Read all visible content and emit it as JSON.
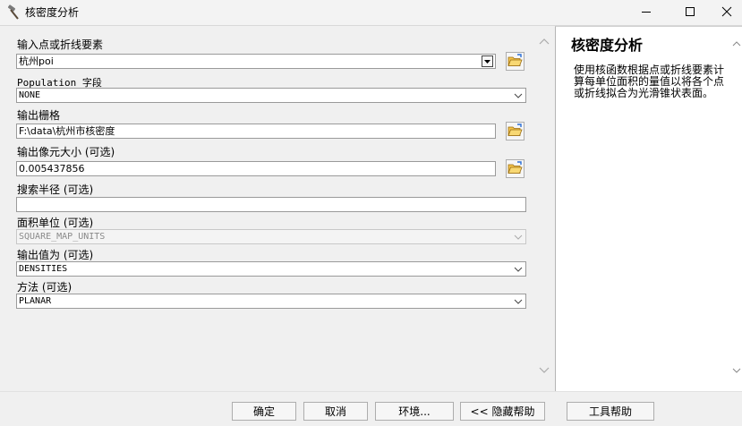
{
  "window": {
    "title": "核密度分析",
    "icon": "hammer-icon"
  },
  "form": {
    "input_label": "输入点或折线要素",
    "input_value": "杭州poi",
    "population_label": "Population 字段",
    "population_value": "NONE",
    "raster_label": "输出栅格",
    "raster_value": "F:\\data\\杭州市核密度",
    "cellsize_label": "输出像元大小 (可选)",
    "cellsize_value": "0.005437856",
    "radius_label": "搜索半径 (可选)",
    "radius_value": "",
    "area_label": "面积单位 (可选)",
    "area_value": "SQUARE_MAP_UNITS",
    "outvalue_label": "输出值为 (可选)",
    "outvalue_value": "DENSITIES",
    "method_label": "方法 (可选)",
    "method_value": "PLANAR"
  },
  "help": {
    "title": "核密度分析",
    "body": "使用核函数根据点或折线要素计算每单位面积的量值以将各个点或折线拟合为光滑锥状表面。"
  },
  "buttons": {
    "ok": "确定",
    "cancel": "取消",
    "env": "环境...",
    "hide_help": "<< 隐藏帮助",
    "tool_help": "工具帮助"
  }
}
